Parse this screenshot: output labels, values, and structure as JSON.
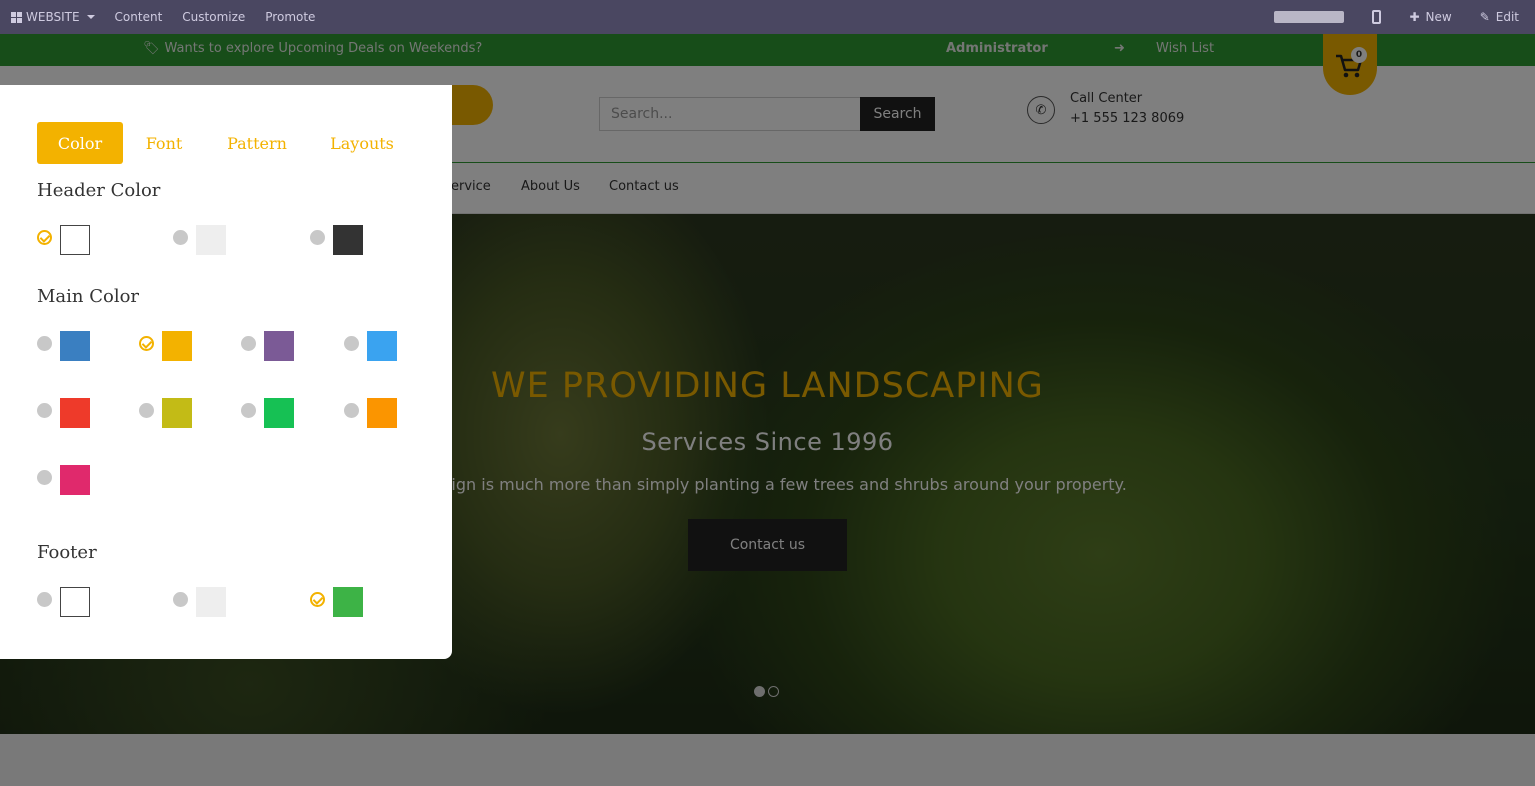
{
  "topbar": {
    "website_label": "WEBSITE",
    "menu": [
      "Content",
      "Customize",
      "Promote"
    ],
    "new_label": "New",
    "edit_label": "Edit"
  },
  "announcement": {
    "deals_text": "Wants to explore Upcoming Deals on Weekends?",
    "user": "Administrator",
    "wishlist": "Wish List"
  },
  "header": {
    "search_placeholder": "Search...",
    "search_button": "Search",
    "call_label": "Call Center",
    "call_number": "+1 555 123 8069",
    "cart_count": "0"
  },
  "nav": {
    "items": [
      "ervice",
      "About Us",
      "Contact us"
    ]
  },
  "hero": {
    "title": "WE PROVIDING LANDSCAPING",
    "subtitle": "Services Since 1996",
    "description": "e design is much more than simply planting a few trees and shrubs around your property.",
    "button": "Contact us",
    "slides": 2,
    "active_slide": 1
  },
  "customizer": {
    "tabs": [
      "Color",
      "Font",
      "Pattern",
      "Layouts"
    ],
    "active_tab": "Color",
    "header_color": {
      "title": "Header Color",
      "options": [
        "#ffffff",
        "#eeeeee",
        "#333333"
      ],
      "selected": 0
    },
    "main_color": {
      "title": "Main Color",
      "options": [
        "#3a7fc1",
        "#f3b200",
        "#7b5a96",
        "#3aa3f0",
        "#ee3a2a",
        "#c3bb16",
        "#16c154",
        "#fb9500",
        "#e0296c"
      ],
      "selected": 1
    },
    "footer": {
      "title": "Footer",
      "options": [
        "#ffffff",
        "#eeeeee",
        "#3db346"
      ],
      "selected": 2
    }
  }
}
